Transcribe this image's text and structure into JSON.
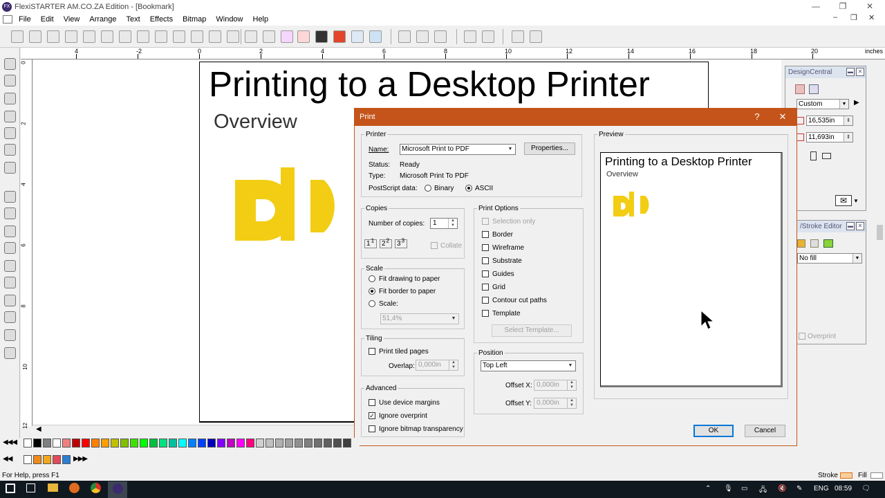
{
  "window": {
    "title": "FlexiSTARTER AM.CO.ZA Edition - [Bookmark]",
    "minimize": "—",
    "maximize": "❐",
    "close": "✕",
    "app_icon": "FX"
  },
  "menu": [
    "File",
    "Edit",
    "View",
    "Arrange",
    "Text",
    "Effects",
    "Bitmap",
    "Window",
    "Help"
  ],
  "mdi_controls": {
    "minimize": "–",
    "restore": "❐",
    "close": "✕"
  },
  "ruler": {
    "unit": "inches",
    "h_ticks": [
      "4",
      "-2",
      "0",
      "2",
      "4",
      "6",
      "8",
      "10",
      "12",
      "14",
      "16",
      "18",
      "20"
    ],
    "v_ticks": [
      "0",
      "2",
      "4",
      "6",
      "8",
      "10",
      "12"
    ]
  },
  "document": {
    "title": "Printing to a Desktop Printer",
    "subtitle": "Overview"
  },
  "design_central": {
    "title": "DesignCentral",
    "size_preset": "Custom",
    "width": "16,535in",
    "height": "11,693in",
    "stroke_title": "/Stroke Editor",
    "fill_value": "No fill",
    "overprint_label": "Overprint"
  },
  "dialog": {
    "title": "Print",
    "help": "?",
    "close": "✕",
    "printer": {
      "legend": "Printer",
      "name_label": "Name:",
      "name_value": "Microsoft Print to PDF",
      "properties": "Properties...",
      "status_label": "Status:",
      "status_value": "Ready",
      "type_label": "Type:",
      "type_value": "Microsoft Print To PDF",
      "postscript_label": "PostScript data:",
      "binary": "Binary",
      "ascii": "ASCII"
    },
    "copies": {
      "legend": "Copies",
      "number_label": "Number of copies:",
      "number_value": "1",
      "collate": "Collate"
    },
    "scale": {
      "legend": "Scale",
      "fit_drawing": "Fit drawing to paper",
      "fit_border": "Fit border to paper",
      "scale_label": "Scale:",
      "scale_value": "51,4%"
    },
    "tiling": {
      "legend": "Tiling",
      "print_tiled": "Print tiled pages",
      "overlap_label": "Overlap:",
      "overlap_value": "0,000in"
    },
    "advanced": {
      "legend": "Advanced",
      "device_margins": "Use device margins",
      "ignore_overprint": "Ignore overprint",
      "ignore_bitmap": "Ignore bitmap transparency"
    },
    "print_options": {
      "legend": "Print Options",
      "items": [
        {
          "label": "Selection only",
          "checked": false,
          "disabled": true
        },
        {
          "label": "Border",
          "checked": false,
          "disabled": false
        },
        {
          "label": "Wireframe",
          "checked": false,
          "disabled": false
        },
        {
          "label": "Substrate",
          "checked": false,
          "disabled": false
        },
        {
          "label": "Guides",
          "checked": false,
          "disabled": false
        },
        {
          "label": "Grid",
          "checked": false,
          "disabled": false
        },
        {
          "label": "Contour cut paths",
          "checked": false,
          "disabled": false
        },
        {
          "label": "Template",
          "checked": false,
          "disabled": false
        }
      ],
      "select_template": "Select Template..."
    },
    "position": {
      "legend": "Position",
      "value": "Top Left",
      "offset_x_label": "Offset X:",
      "offset_x_value": "0,000in",
      "offset_y_label": "Offset Y:",
      "offset_y_value": "0,000in"
    },
    "preview": {
      "legend": "Preview",
      "title": "Printing to a Desktop Printer",
      "subtitle": "Overview"
    },
    "ok": "OK",
    "cancel": "Cancel"
  },
  "status": {
    "help": "For Help, press F1",
    "stroke": "Stroke",
    "fill": "Fill"
  },
  "taskbar": {
    "lang": "ENG",
    "time": "08:59"
  },
  "colors": {
    "accent": "#c4541a",
    "logo_yellow": "#f2cd14"
  }
}
